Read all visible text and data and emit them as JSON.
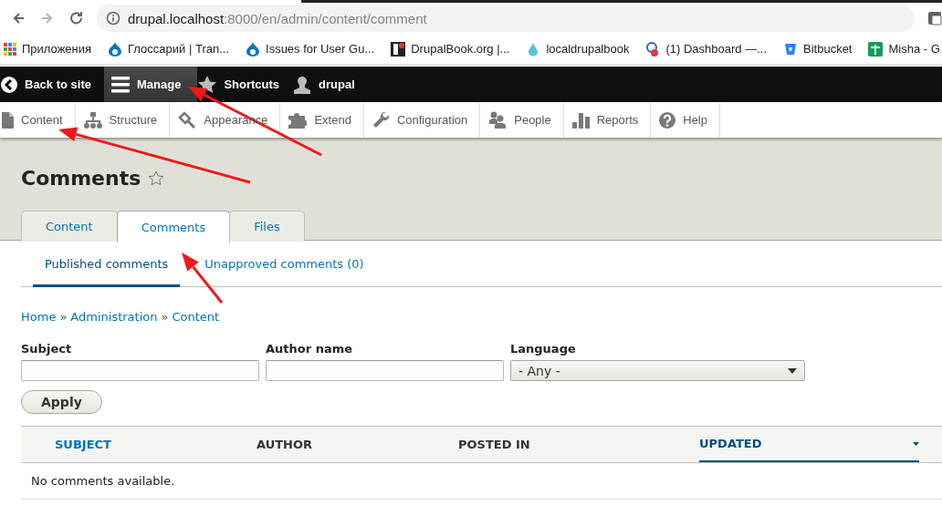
{
  "browser": {
    "url_host": "drupal.localhost",
    "url_path": ":8000/en/admin/content/comment",
    "bookmarks": [
      {
        "label": "Приложения"
      },
      {
        "label": "Глоссарий | Tran..."
      },
      {
        "label": "Issues for User Gu..."
      },
      {
        "label": "DrupalBook.org |..."
      },
      {
        "label": "localdrupalbook"
      },
      {
        "label": "(1) Dashboard —..."
      },
      {
        "label": "Bitbucket"
      },
      {
        "label": "Misha - G"
      }
    ]
  },
  "toolbar": {
    "items": [
      {
        "label": "Back to site",
        "selected": false
      },
      {
        "label": "Manage",
        "selected": true
      },
      {
        "label": "Shortcuts",
        "selected": false
      },
      {
        "label": "drupal",
        "selected": false
      }
    ]
  },
  "tray": {
    "items": [
      {
        "label": "Content"
      },
      {
        "label": "Structure"
      },
      {
        "label": "Appearance"
      },
      {
        "label": "Extend"
      },
      {
        "label": "Configuration"
      },
      {
        "label": "People"
      },
      {
        "label": "Reports"
      },
      {
        "label": "Help"
      }
    ]
  },
  "page_title": "Comments",
  "tabs": [
    {
      "label": "Content",
      "selected": false
    },
    {
      "label": "Comments",
      "selected": true
    },
    {
      "label": "Files",
      "selected": false
    }
  ],
  "secondary_tabs": [
    {
      "label": "Published comments",
      "selected": true
    },
    {
      "label": "Unapproved comments (0)",
      "selected": false
    }
  ],
  "breadcrumb": [
    {
      "label": "Home",
      "kind": "link"
    },
    {
      "label": "»",
      "kind": "separator"
    },
    {
      "label": "Administration",
      "kind": "link"
    },
    {
      "label": "»",
      "kind": "separator"
    },
    {
      "label": "Content",
      "kind": "link"
    }
  ],
  "filters": [
    {
      "label": "Subject",
      "kind": "text"
    },
    {
      "label": "Author name",
      "kind": "text"
    },
    {
      "label": "Language",
      "kind": "select",
      "value": "- Any -"
    }
  ],
  "apply_button": "Apply",
  "table": {
    "columns": [
      {
        "label": "SUBJECT",
        "sortable": true,
        "active": false
      },
      {
        "label": "AUTHOR",
        "sortable": false,
        "active": false
      },
      {
        "label": "POSTED IN",
        "sortable": false,
        "active": false
      },
      {
        "label": "UPDATED",
        "sortable": true,
        "active": true
      }
    ],
    "empty_message": "No comments available."
  }
}
